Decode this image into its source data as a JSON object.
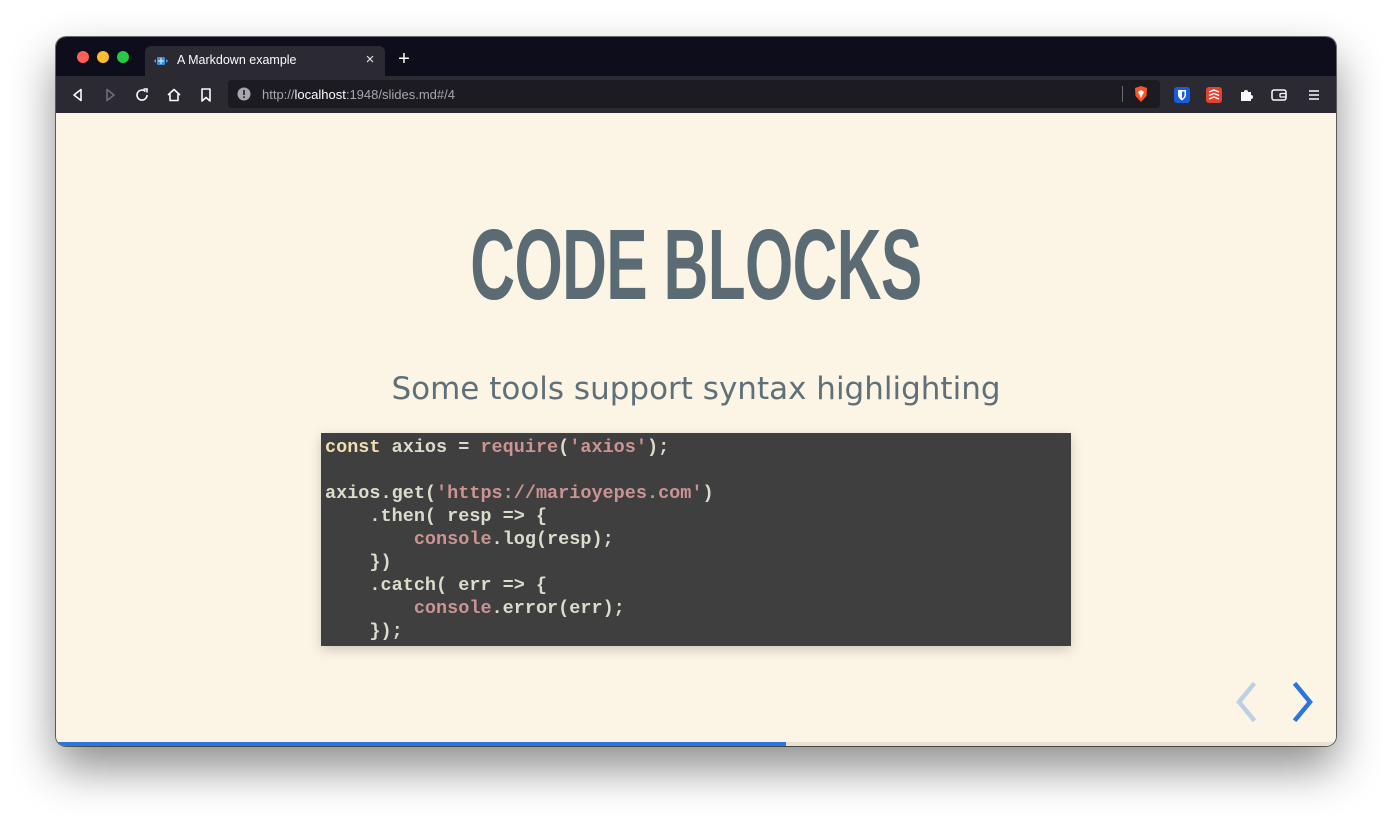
{
  "tab": {
    "title": "A Markdown example",
    "close_glyph": "×",
    "new_tab_glyph": "+"
  },
  "urlbar": {
    "scheme": "http://",
    "host": "localhost",
    "rest": ":1948/slides.md#/4"
  },
  "icons": {
    "toolbar_left": [
      "back-icon",
      "forward-icon",
      "reload-icon",
      "home-icon",
      "bookmark-icon"
    ],
    "toolbar_right": [
      "brave-shield-icon",
      "bitwarden-icon",
      "todoist-icon",
      "extensions-icon",
      "wallet-icon",
      "menu-icon"
    ]
  },
  "slide": {
    "title": "CODE BLOCKS",
    "subtitle": "Some tools support syntax highlighting",
    "code": {
      "language": "javascript",
      "lines": [
        [
          [
            "kw",
            "const"
          ],
          [
            "",
            " axios = "
          ],
          [
            "fn",
            "require"
          ],
          [
            "",
            "("
          ],
          [
            "str",
            "'axios'"
          ],
          [
            "",
            ");"
          ]
        ],
        [],
        [
          [
            "",
            "axios.get("
          ],
          [
            "str",
            "'https://marioyepes.com'"
          ],
          [
            "",
            ")"
          ]
        ],
        [
          [
            "",
            "    .then( resp => {"
          ]
        ],
        [
          [
            "",
            "        "
          ],
          [
            "fn",
            "console"
          ],
          [
            "",
            ".log(resp);"
          ]
        ],
        [
          [
            "",
            "    })"
          ]
        ],
        [
          [
            "",
            "    .catch( err => {"
          ]
        ],
        [
          [
            "",
            "        "
          ],
          [
            "fn",
            "console"
          ],
          [
            "",
            ".error(err);"
          ]
        ],
        [
          [
            "",
            "    });"
          ]
        ]
      ]
    }
  },
  "progress": 0.57,
  "colors": {
    "slide_bg": "#fcf5e6",
    "title": "#5a6b73",
    "code_bg": "#3f3f3f",
    "progress": "#2a76dd",
    "nav_arrow": "#2a76dd"
  }
}
